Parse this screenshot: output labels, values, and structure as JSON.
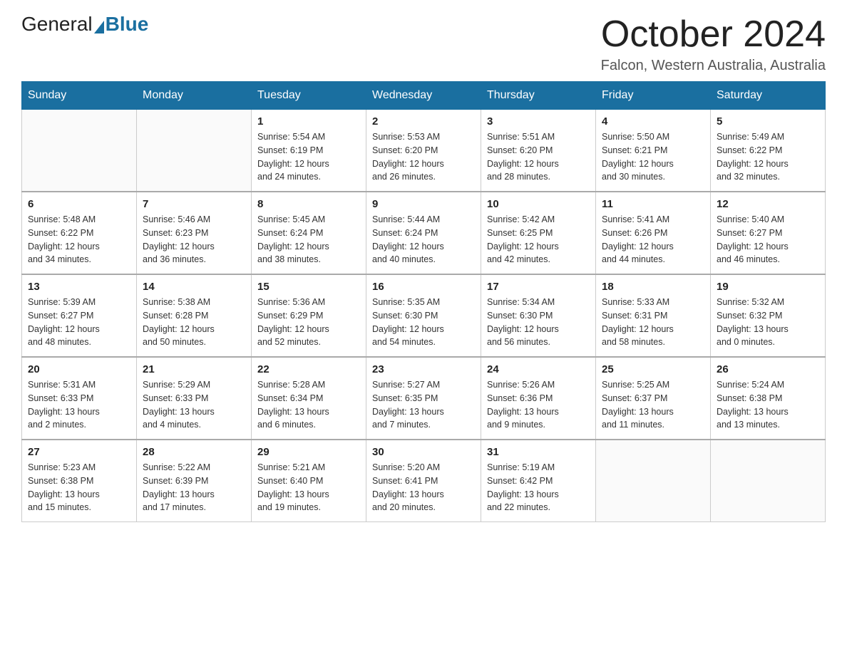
{
  "logo": {
    "general": "General",
    "blue": "Blue"
  },
  "title": "October 2024",
  "subtitle": "Falcon, Western Australia, Australia",
  "days_header": [
    "Sunday",
    "Monday",
    "Tuesday",
    "Wednesday",
    "Thursday",
    "Friday",
    "Saturday"
  ],
  "weeks": [
    [
      {
        "day": "",
        "info": ""
      },
      {
        "day": "",
        "info": ""
      },
      {
        "day": "1",
        "info": "Sunrise: 5:54 AM\nSunset: 6:19 PM\nDaylight: 12 hours\nand 24 minutes."
      },
      {
        "day": "2",
        "info": "Sunrise: 5:53 AM\nSunset: 6:20 PM\nDaylight: 12 hours\nand 26 minutes."
      },
      {
        "day": "3",
        "info": "Sunrise: 5:51 AM\nSunset: 6:20 PM\nDaylight: 12 hours\nand 28 minutes."
      },
      {
        "day": "4",
        "info": "Sunrise: 5:50 AM\nSunset: 6:21 PM\nDaylight: 12 hours\nand 30 minutes."
      },
      {
        "day": "5",
        "info": "Sunrise: 5:49 AM\nSunset: 6:22 PM\nDaylight: 12 hours\nand 32 minutes."
      }
    ],
    [
      {
        "day": "6",
        "info": "Sunrise: 5:48 AM\nSunset: 6:22 PM\nDaylight: 12 hours\nand 34 minutes."
      },
      {
        "day": "7",
        "info": "Sunrise: 5:46 AM\nSunset: 6:23 PM\nDaylight: 12 hours\nand 36 minutes."
      },
      {
        "day": "8",
        "info": "Sunrise: 5:45 AM\nSunset: 6:24 PM\nDaylight: 12 hours\nand 38 minutes."
      },
      {
        "day": "9",
        "info": "Sunrise: 5:44 AM\nSunset: 6:24 PM\nDaylight: 12 hours\nand 40 minutes."
      },
      {
        "day": "10",
        "info": "Sunrise: 5:42 AM\nSunset: 6:25 PM\nDaylight: 12 hours\nand 42 minutes."
      },
      {
        "day": "11",
        "info": "Sunrise: 5:41 AM\nSunset: 6:26 PM\nDaylight: 12 hours\nand 44 minutes."
      },
      {
        "day": "12",
        "info": "Sunrise: 5:40 AM\nSunset: 6:27 PM\nDaylight: 12 hours\nand 46 minutes."
      }
    ],
    [
      {
        "day": "13",
        "info": "Sunrise: 5:39 AM\nSunset: 6:27 PM\nDaylight: 12 hours\nand 48 minutes."
      },
      {
        "day": "14",
        "info": "Sunrise: 5:38 AM\nSunset: 6:28 PM\nDaylight: 12 hours\nand 50 minutes."
      },
      {
        "day": "15",
        "info": "Sunrise: 5:36 AM\nSunset: 6:29 PM\nDaylight: 12 hours\nand 52 minutes."
      },
      {
        "day": "16",
        "info": "Sunrise: 5:35 AM\nSunset: 6:30 PM\nDaylight: 12 hours\nand 54 minutes."
      },
      {
        "day": "17",
        "info": "Sunrise: 5:34 AM\nSunset: 6:30 PM\nDaylight: 12 hours\nand 56 minutes."
      },
      {
        "day": "18",
        "info": "Sunrise: 5:33 AM\nSunset: 6:31 PM\nDaylight: 12 hours\nand 58 minutes."
      },
      {
        "day": "19",
        "info": "Sunrise: 5:32 AM\nSunset: 6:32 PM\nDaylight: 13 hours\nand 0 minutes."
      }
    ],
    [
      {
        "day": "20",
        "info": "Sunrise: 5:31 AM\nSunset: 6:33 PM\nDaylight: 13 hours\nand 2 minutes."
      },
      {
        "day": "21",
        "info": "Sunrise: 5:29 AM\nSunset: 6:33 PM\nDaylight: 13 hours\nand 4 minutes."
      },
      {
        "day": "22",
        "info": "Sunrise: 5:28 AM\nSunset: 6:34 PM\nDaylight: 13 hours\nand 6 minutes."
      },
      {
        "day": "23",
        "info": "Sunrise: 5:27 AM\nSunset: 6:35 PM\nDaylight: 13 hours\nand 7 minutes."
      },
      {
        "day": "24",
        "info": "Sunrise: 5:26 AM\nSunset: 6:36 PM\nDaylight: 13 hours\nand 9 minutes."
      },
      {
        "day": "25",
        "info": "Sunrise: 5:25 AM\nSunset: 6:37 PM\nDaylight: 13 hours\nand 11 minutes."
      },
      {
        "day": "26",
        "info": "Sunrise: 5:24 AM\nSunset: 6:38 PM\nDaylight: 13 hours\nand 13 minutes."
      }
    ],
    [
      {
        "day": "27",
        "info": "Sunrise: 5:23 AM\nSunset: 6:38 PM\nDaylight: 13 hours\nand 15 minutes."
      },
      {
        "day": "28",
        "info": "Sunrise: 5:22 AM\nSunset: 6:39 PM\nDaylight: 13 hours\nand 17 minutes."
      },
      {
        "day": "29",
        "info": "Sunrise: 5:21 AM\nSunset: 6:40 PM\nDaylight: 13 hours\nand 19 minutes."
      },
      {
        "day": "30",
        "info": "Sunrise: 5:20 AM\nSunset: 6:41 PM\nDaylight: 13 hours\nand 20 minutes."
      },
      {
        "day": "31",
        "info": "Sunrise: 5:19 AM\nSunset: 6:42 PM\nDaylight: 13 hours\nand 22 minutes."
      },
      {
        "day": "",
        "info": ""
      },
      {
        "day": "",
        "info": ""
      }
    ]
  ]
}
